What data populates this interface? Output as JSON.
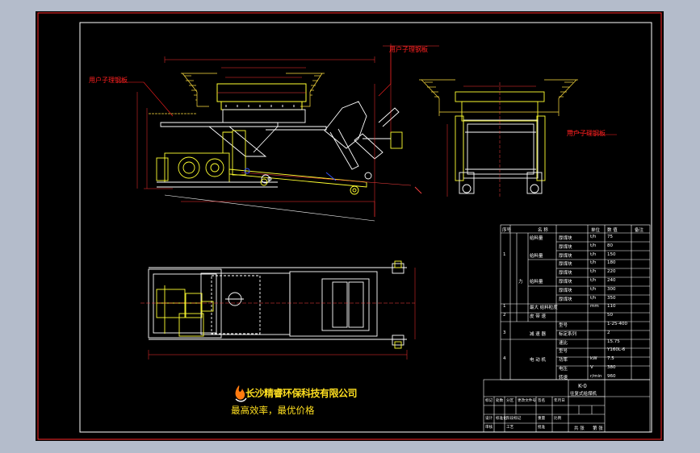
{
  "colors": {
    "background": "#b4bccb",
    "canvas": "#000000",
    "frame": "#ff2a2a",
    "outline": "#ffffff",
    "structure": "#ffff30",
    "hatch": "#ffe040",
    "dimension": "#ff3030",
    "axis": "#ff4040",
    "blue_mark": "#3050ff",
    "note_text": "#ff2020",
    "company_text": "#ffdf20"
  },
  "icons": {
    "logo": "flame-logo-icon"
  },
  "notes": {
    "side_view_top": "用户子理钢板",
    "side_view_left": "用户子理钢板",
    "end_view": "用户子理钢板"
  },
  "company": {
    "name": "长沙精睿环保科技有限公司",
    "slogan": "最高效率，最优价格"
  },
  "spec_table": {
    "headers": [
      "序号",
      "名 称",
      "单位",
      "数 值",
      "备注"
    ],
    "rows": [
      {
        "no": "",
        "name": "",
        "sub": "给料量",
        "spec": "厚煤块",
        "unit": "t/h",
        "value": "75"
      },
      {
        "no": "",
        "name": "",
        "sub": "",
        "spec": "厚煤块",
        "unit": "t/h",
        "value": "80"
      },
      {
        "no": "1",
        "name": "",
        "sub": "给料量",
        "spec": "厚煤块",
        "unit": "t/h",
        "value": "150"
      },
      {
        "no": "",
        "name": "",
        "sub": "",
        "spec": "厚煤块",
        "unit": "t/h",
        "value": "180"
      },
      {
        "no": "",
        "name": "",
        "sub": "",
        "spec": "厚煤块",
        "unit": "t/h",
        "value": "220"
      },
      {
        "no": "",
        "name": "力",
        "sub": "给料量",
        "spec": "厚煤块",
        "unit": "t/h",
        "value": "240"
      },
      {
        "no": "",
        "name": "",
        "sub": "",
        "spec": "厚煤块",
        "unit": "t/h",
        "value": "300"
      },
      {
        "no": "",
        "name": "",
        "sub": "",
        "spec": "厚煤块",
        "unit": "t/h",
        "value": "350"
      },
      {
        "no": "1",
        "name": "",
        "sub": "最大 给料粒度",
        "spec": "",
        "unit": "mm",
        "value": "110"
      },
      {
        "no": "2",
        "name": "",
        "sub": "皮 带 速",
        "spec": "",
        "unit": "",
        "value": "50"
      },
      {
        "no": "",
        "name": "",
        "sub": "",
        "spec": "型号",
        "unit": "",
        "value": "1-25-400"
      },
      {
        "no": "3",
        "name": "",
        "sub": "减 速 器",
        "spec": "标定系列",
        "unit": "",
        "value": "2"
      },
      {
        "no": "",
        "name": "",
        "sub": "",
        "spec": "速比",
        "unit": "",
        "value": "15.75"
      },
      {
        "no": "",
        "name": "",
        "sub": "",
        "spec": "型号",
        "unit": "",
        "value": "Y160L-6"
      },
      {
        "no": "4",
        "name": "",
        "sub": "电 动 机",
        "spec": "功率",
        "unit": "kW",
        "value": "7.5"
      },
      {
        "no": "",
        "name": "",
        "sub": "",
        "spec": "电压",
        "unit": "V",
        "value": "380"
      },
      {
        "no": "",
        "name": "",
        "sub": "",
        "spec": "转速",
        "unit": "r/min",
        "value": "960"
      }
    ]
  },
  "title_block": {
    "drawing_title": "K-0",
    "drawing_subtitle": "往复式给煤机",
    "labels": [
      "标记",
      "处数",
      "分区",
      "更改文件号",
      "签名",
      "年月日",
      "设计",
      "标准化",
      "阶段标记",
      "重量",
      "比例",
      "审核",
      "工艺",
      "批准"
    ],
    "scale_label": "共 张",
    "sheet_label": "第 张"
  }
}
